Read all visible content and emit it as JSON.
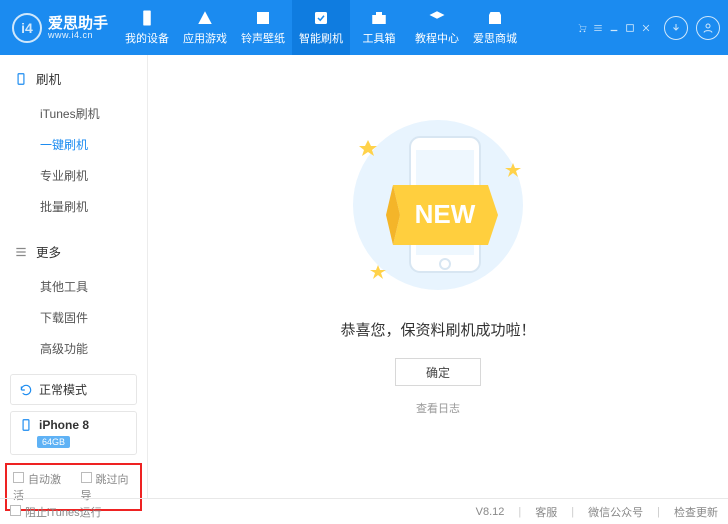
{
  "brand": {
    "title": "爱思助手",
    "subtitle": "www.i4.cn",
    "logo_letters": "i4"
  },
  "nav": [
    {
      "label": "我的设备"
    },
    {
      "label": "应用游戏"
    },
    {
      "label": "铃声壁纸"
    },
    {
      "label": "智能刷机",
      "active": true
    },
    {
      "label": "工具箱"
    },
    {
      "label": "教程中心"
    },
    {
      "label": "爱思商城"
    }
  ],
  "sidebar": {
    "section1_title": "刷机",
    "section1_items": [
      "iTunes刷机",
      "一键刷机",
      "专业刷机",
      "批量刷机"
    ],
    "section1_active_index": 1,
    "section2_title": "更多",
    "section2_items": [
      "其他工具",
      "下载固件",
      "高级功能"
    ],
    "status_mode": "正常模式",
    "device_name": "iPhone 8",
    "device_storage": "64GB",
    "checkbox1": "自动激活",
    "checkbox2": "跳过向导"
  },
  "main": {
    "banner_text": "NEW",
    "success_msg": "恭喜您，保资料刷机成功啦！",
    "ok_btn": "确定",
    "log_link": "查看日志"
  },
  "footer": {
    "left_checkbox": "阻止iTunes运行",
    "version": "V8.12",
    "r1": "客服",
    "r2": "微信公众号",
    "r3": "检查更新"
  }
}
